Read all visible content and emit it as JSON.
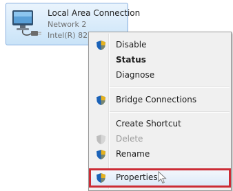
{
  "adapter": {
    "name": "Local Area Connection",
    "network": "Network  2",
    "device": "Intel(R) 82"
  },
  "menu": {
    "items": [
      {
        "label": "Disable",
        "icon": "uac-shield-icon"
      },
      {
        "label": "Status",
        "style": "bold"
      },
      {
        "label": "Diagnose"
      },
      {
        "label": "Bridge Connections",
        "icon": "uac-shield-icon"
      },
      {
        "label": "Create Shortcut"
      },
      {
        "label": "Delete",
        "icon": "uac-shield-icon",
        "state": "disabled"
      },
      {
        "label": "Rename",
        "icon": "uac-shield-icon"
      },
      {
        "label": "Properties",
        "icon": "uac-shield-icon",
        "state": "highlighted"
      }
    ]
  },
  "colors": {
    "highlight_outline": "#cc2c35",
    "tile_border": "#84acdd",
    "menu_background": "#f0f0f0"
  }
}
